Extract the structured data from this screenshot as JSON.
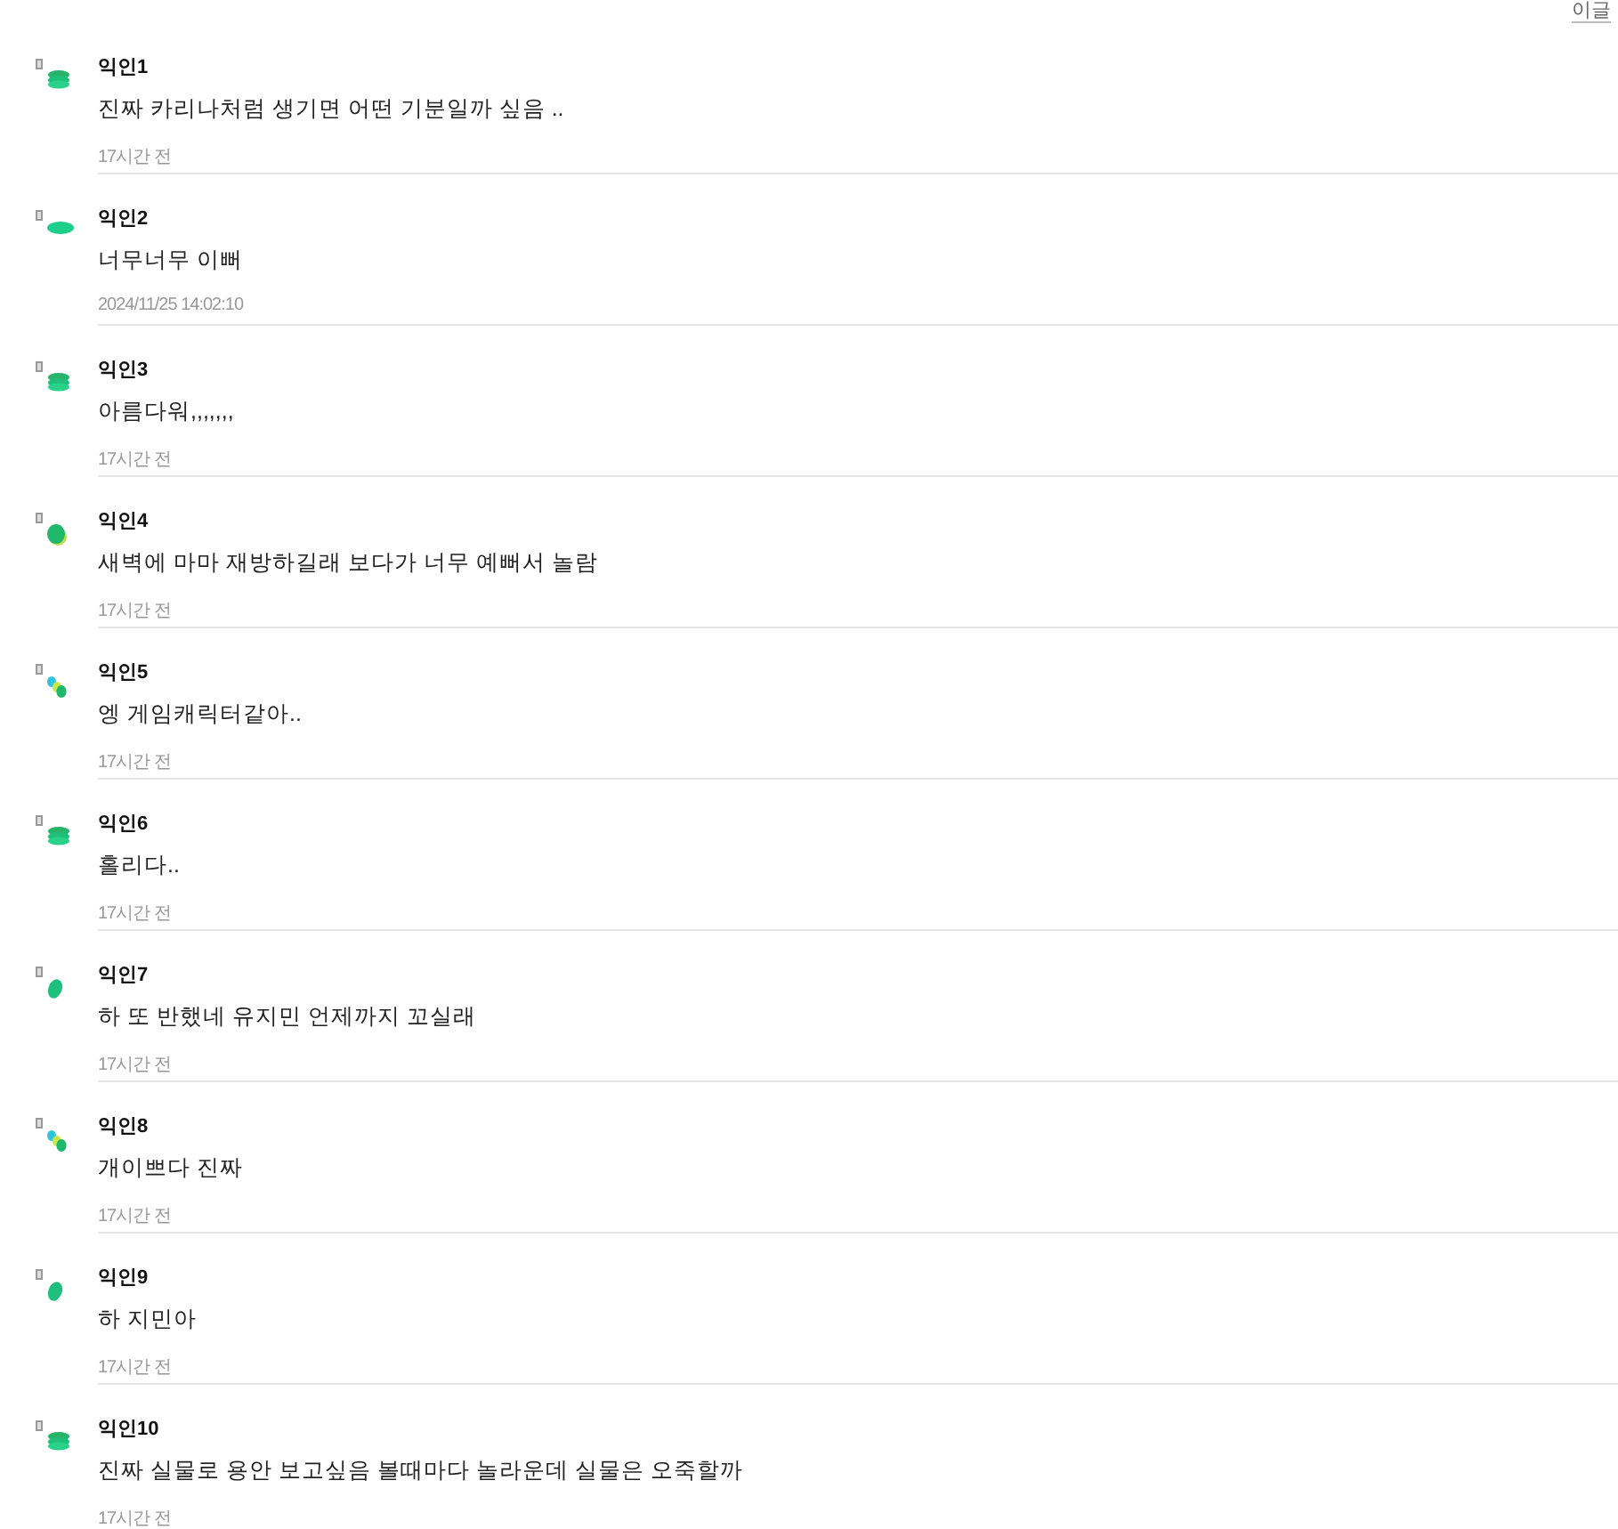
{
  "top_link": "이글",
  "comments": [
    {
      "author": "익인1",
      "text": "진짜 카리나처럼 생기면 어떤 기분일까 싶음 ..",
      "time": "17시간 전",
      "kind": "stack"
    },
    {
      "author": "익인2",
      "text": "너무너무 이뻐",
      "time": "2024/11/25 14:02:10",
      "kind": "disc"
    },
    {
      "author": "익인3",
      "text": "아름다워,,,,,,,",
      "time": "17시간 전",
      "kind": "stack"
    },
    {
      "author": "익인4",
      "text": "새벽에 마마 재방하길래 보다가 너무 예뻐서 놀람",
      "time": "17시간 전",
      "kind": "oval"
    },
    {
      "author": "익인5",
      "text": "엥 게임캐릭터같아..",
      "time": "17시간 전",
      "kind": "trio"
    },
    {
      "author": "익인6",
      "text": "홀리다..",
      "time": "17시간 전",
      "kind": "stack"
    },
    {
      "author": "익인7",
      "text": "하 또 반했네 유지민 언제까지 꼬실래",
      "time": "17시간 전",
      "kind": "tilt"
    },
    {
      "author": "익인8",
      "text": "개이쁘다 진짜",
      "time": "17시간 전",
      "kind": "trio"
    },
    {
      "author": "익인9",
      "text": "하 지민아",
      "time": "17시간 전",
      "kind": "tilt"
    },
    {
      "author": "익인10",
      "text": "진짜 실물로 용안 보고싶음 볼때마다 놀라운데 실물은 오죽할까",
      "time": "17시간 전",
      "kind": "stack"
    }
  ]
}
